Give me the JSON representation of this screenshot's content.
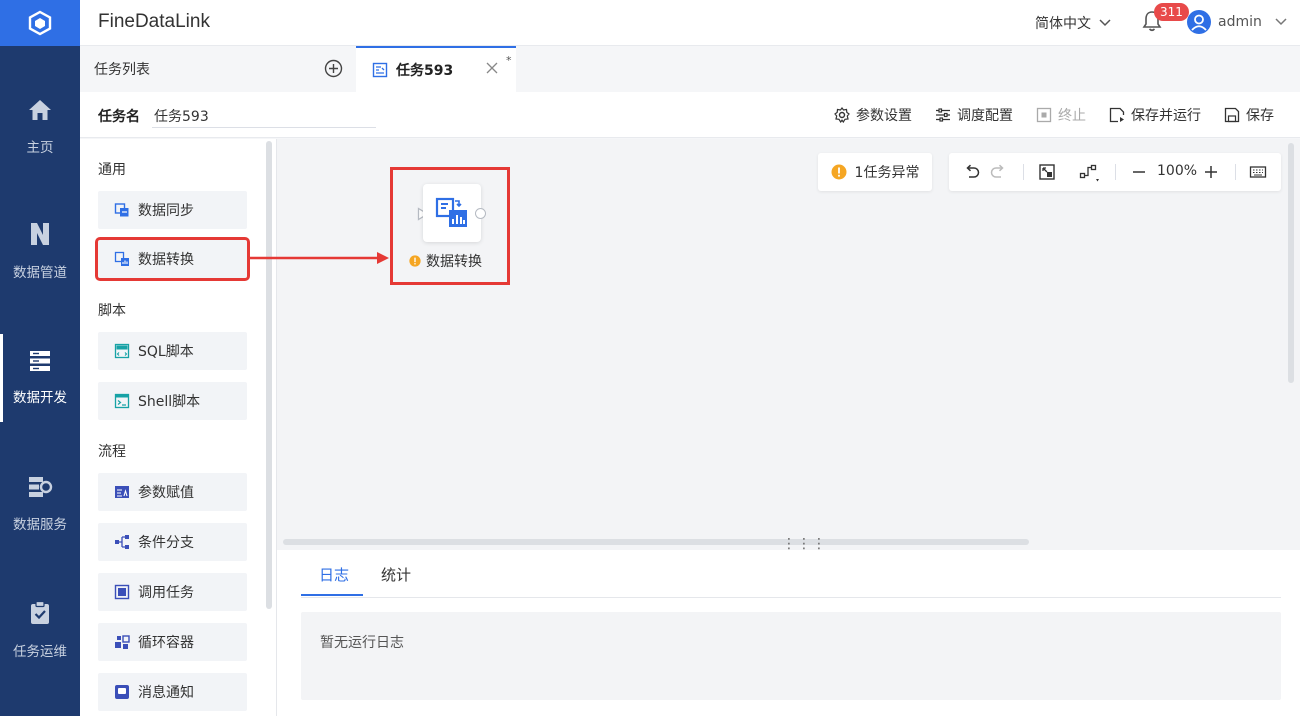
{
  "colors": {
    "nav_bg": "#1e3a6e",
    "accent": "#2f6fe5",
    "highlight": "#e53935",
    "warning": "#f5a623",
    "badge": "#e84a4a"
  },
  "app": {
    "title": "FineDataLink"
  },
  "nav": [
    {
      "label": "主页",
      "icon": "home-icon"
    },
    {
      "label": "数据管道",
      "icon": "pipeline-icon"
    },
    {
      "label": "数据开发",
      "icon": "dev-icon",
      "active": true
    },
    {
      "label": "数据服务",
      "icon": "service-icon"
    },
    {
      "label": "任务运维",
      "icon": "ops-icon"
    }
  ],
  "header": {
    "language": "简体中文",
    "notifications": "311",
    "user": "admin"
  },
  "tabs": {
    "list_label": "任务列表",
    "active_label": "任务593",
    "dirty_mark": "*"
  },
  "task": {
    "name_label": "任务名",
    "name_value": "任务593"
  },
  "toolbar": {
    "params": "参数设置",
    "schedule": "调度配置",
    "stop": "终止",
    "save_run": "保存并运行",
    "save": "保存"
  },
  "palette": {
    "sections": [
      {
        "title": "通用",
        "items": [
          "数据同步",
          "数据转换"
        ]
      },
      {
        "title": "脚本",
        "items": [
          "SQL脚本",
          "Shell脚本"
        ]
      },
      {
        "title": "流程",
        "items": [
          "参数赋值",
          "条件分支",
          "调用任务",
          "循环容器",
          "消息通知"
        ]
      }
    ]
  },
  "canvas": {
    "warning": "1任务异常",
    "zoom": "100%",
    "node_label": "数据转换"
  },
  "log": {
    "tabs": [
      "日志",
      "统计"
    ],
    "empty": "暂无运行日志"
  }
}
